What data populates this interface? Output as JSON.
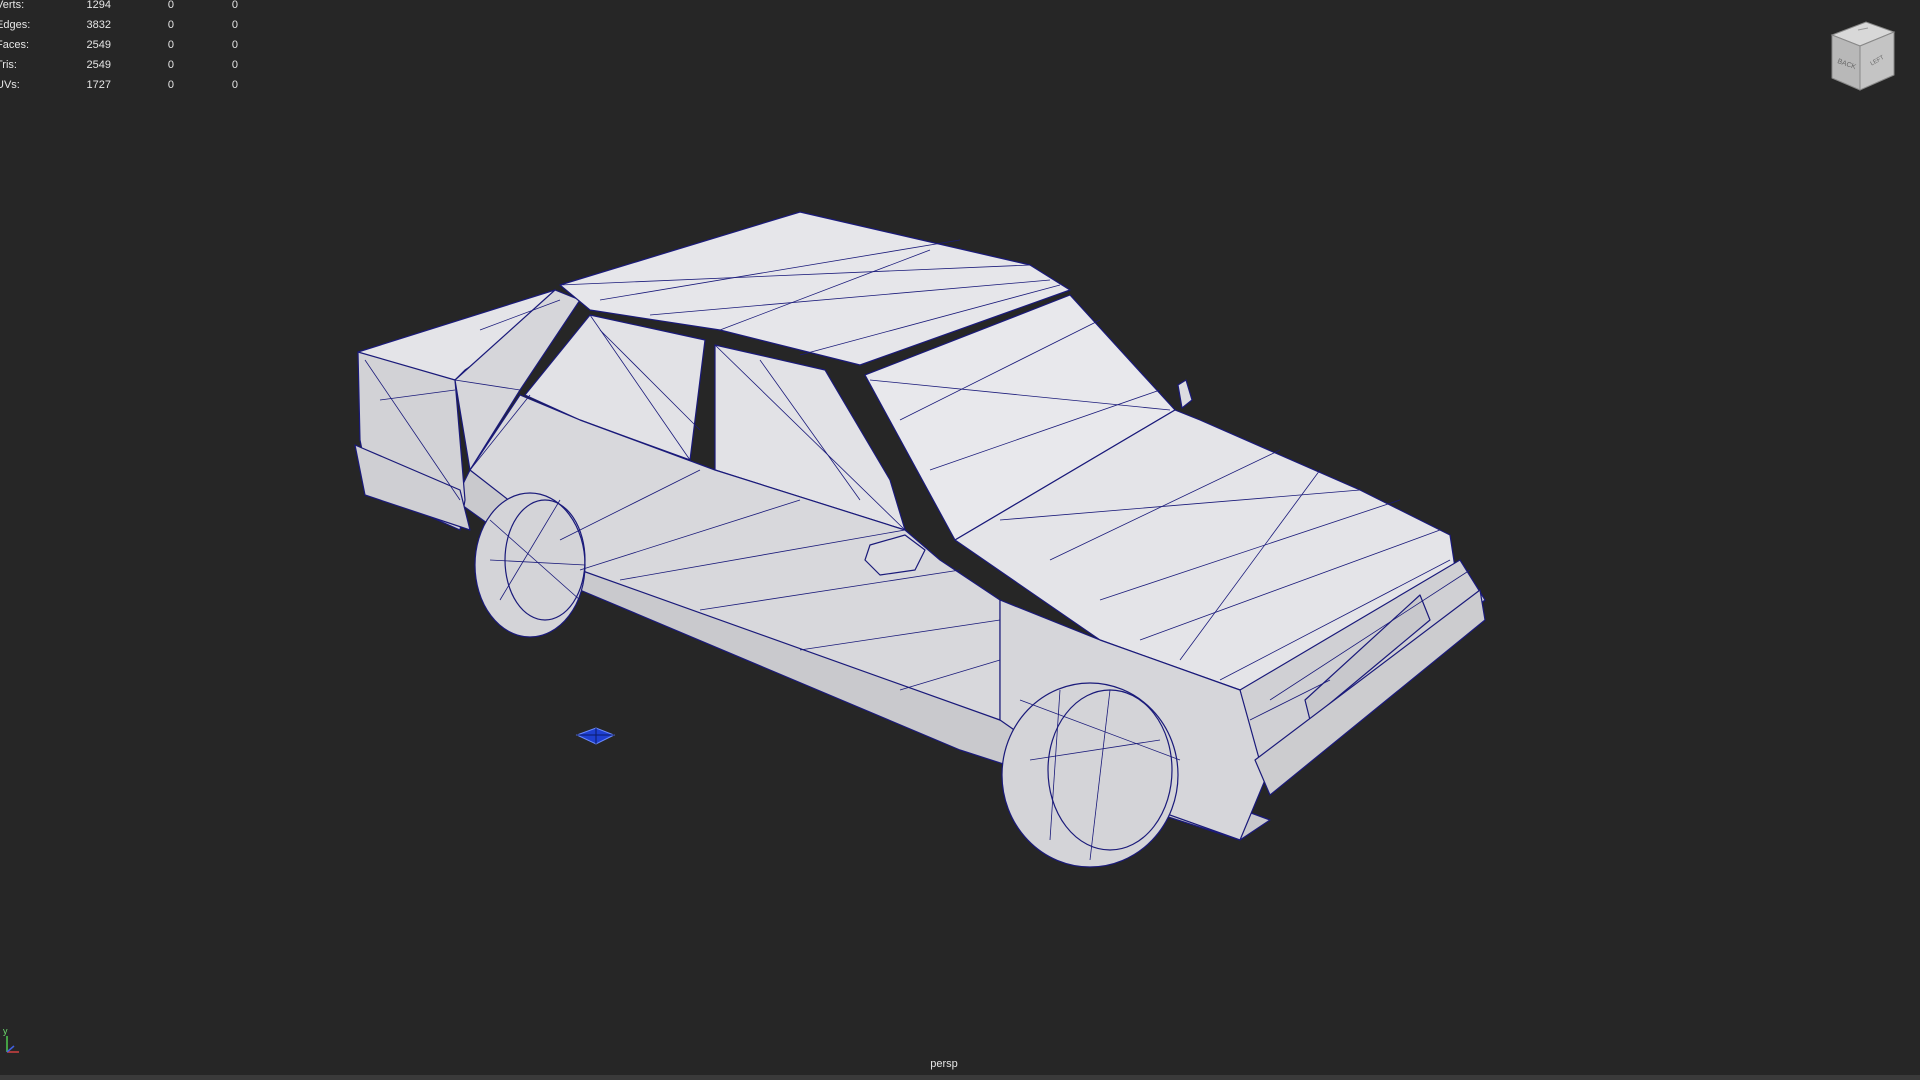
{
  "hud": {
    "rows": [
      {
        "label": "Verts:",
        "v1": "1294",
        "v2": "0",
        "v3": "0"
      },
      {
        "label": "Edges:",
        "v1": "3832",
        "v2": "0",
        "v3": "0"
      },
      {
        "label": "Faces:",
        "v1": "2549",
        "v2": "0",
        "v3": "0"
      },
      {
        "label": "Tris:",
        "v1": "2549",
        "v2": "0",
        "v3": "0"
      },
      {
        "label": "UVs:",
        "v1": "1727",
        "v2": "0",
        "v3": "0"
      }
    ]
  },
  "viewcube": {
    "face_back": "BACK",
    "face_left": "LEFT"
  },
  "camera": {
    "name": "persp"
  },
  "axis": {
    "y_label": "y"
  },
  "colors": {
    "background": "#262626",
    "wire": "#1a1a7a",
    "shading": "#d9d9dd",
    "text": "#e6e6e6"
  }
}
